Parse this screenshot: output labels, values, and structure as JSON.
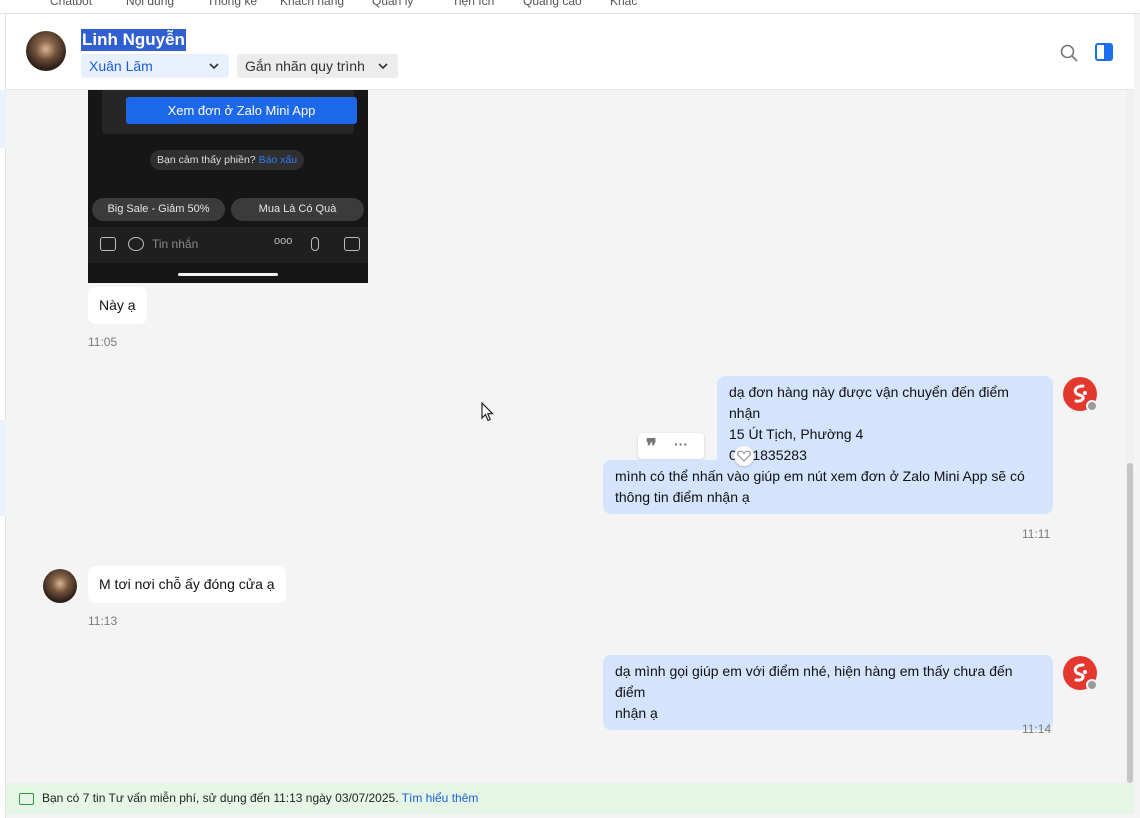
{
  "topnav": [
    "Chatbot",
    "Nội dung",
    "Thống kê",
    "Khách hàng",
    "Quản lý",
    "Tiện ích",
    "Quảng cáo",
    "Khác"
  ],
  "header": {
    "contact_name": "Linh Nguyễn",
    "assignee": "Xuân Lãm",
    "label_placeholder": "Gắn nhãn quy trình",
    "icons": [
      "search-icon",
      "side-panel-icon"
    ]
  },
  "attachment": {
    "view_order_button": "Xem đơn ở Zalo Mini App",
    "report_prompt": "Bạn cảm thấy phiền?",
    "report_link": "Báo xấu",
    "quick_reply_1": "Big Sale - Giảm 50%",
    "quick_reply_2": "Mua Là Có Quà",
    "input_placeholder": "Tin nhắn",
    "input_more": "ooo"
  },
  "messages": [
    {
      "from": "customer",
      "text": "Này ạ",
      "time": "11:05"
    },
    {
      "from": "agent",
      "text": "dạ đơn hàng này được vận chuyển đến điểm nhận\n15 Út Tịch, Phường 4\n0901835283"
    },
    {
      "from": "agent",
      "text": "mình có thể nhấn vào giúp em nút xem đơn ở Zalo Mini App sẽ có\nthông tin điểm nhận ạ",
      "time": "11:11"
    },
    {
      "from": "customer",
      "text": "M tơi nơi chỗ ấy đóng cửa ạ",
      "time": "11:13"
    },
    {
      "from": "agent",
      "text": "dạ mình gọi giúp em với điểm nhé, hiện hàng em thấy chưa đến điểm\nnhận ạ",
      "time": "11:14"
    }
  ],
  "hover_actions": {
    "quote": "❞",
    "more": "···"
  },
  "notice": {
    "text": "Bạn có 7 tin Tư vấn miễn phí, sử dụng đến 11:13 ngày 03/07/2025.",
    "link": "Tìm hiểu thêm"
  },
  "colors": {
    "accent": "#1a6ff0",
    "outgoing_bubble": "#d3e4fc",
    "notice_bg": "#e6f6e6",
    "agent_avatar": "#e4382e"
  }
}
